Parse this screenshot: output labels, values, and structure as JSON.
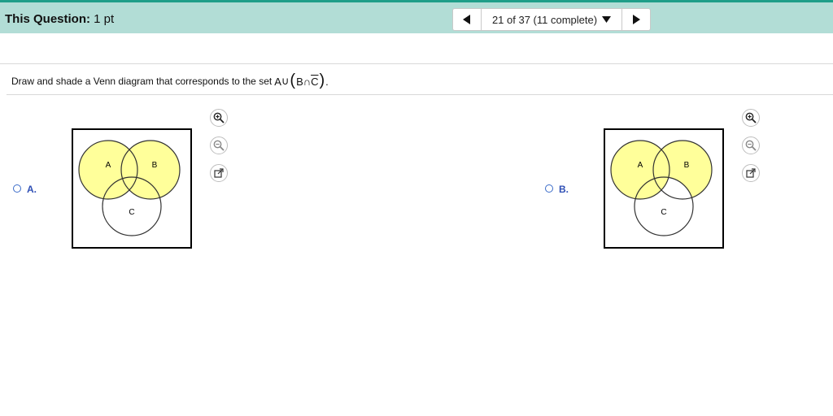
{
  "header": {
    "title_bold": "This Question:",
    "title_rest": "1 pt",
    "nav": {
      "progress": "21 of 37 (11 complete)"
    }
  },
  "question": {
    "text": "Draw and shade a Venn diagram that corresponds to the set",
    "set_a": "A",
    "union": "∪",
    "set_b": "B",
    "intersect": "∩",
    "set_c": "C",
    "period": "."
  },
  "options": [
    {
      "label": "A.",
      "circles": {
        "a": "A",
        "b": "B",
        "c": "C"
      },
      "shaded": "A ∪ B"
    },
    {
      "label": "B.",
      "circles": {
        "a": "A",
        "b": "B",
        "c": "C"
      },
      "shaded": "A ∪ (B ∩ C̄)"
    }
  ],
  "colors": {
    "header_bg": "#b2ddd6",
    "accent_line": "#1f9e89",
    "shade": "#ffff9a",
    "option_label": "#2f4fb5"
  },
  "icons": [
    "previous-arrow-icon",
    "dropdown-caret-icon",
    "next-arrow-icon",
    "zoom-in-icon",
    "zoom-out-icon",
    "popout-icon",
    "radio-icon"
  ]
}
